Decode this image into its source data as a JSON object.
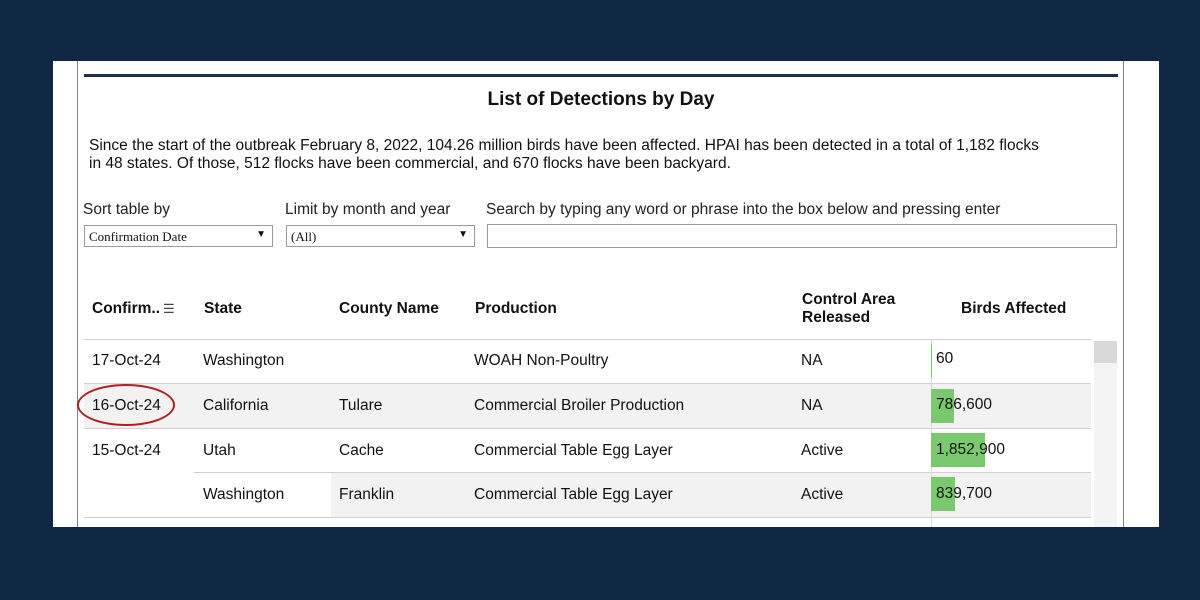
{
  "title": "List of Detections by Day",
  "summary": "Since the start of the outbreak February 8, 2022, 104.26 million birds have been affected.   HPAI has been detected in a total of 1,182 flocks in 48 states. Of those, 512 flocks have been commercial, and 670 flocks have been backyard.",
  "filters": {
    "sort_label": "Sort table by",
    "sort_value": "Confirmation Date",
    "month_label": "Limit by month and year",
    "month_value": "(All)",
    "search_label": "Search by typing any word or phrase into the box below and pressing enter",
    "search_value": ""
  },
  "table": {
    "headers": {
      "confirm": "Confirm..",
      "state": "State",
      "county": "County Name",
      "production": "Production",
      "control_line1": "Control Area",
      "control_line2": "Released",
      "birds": "Birds Affected"
    },
    "rows": [
      {
        "date": "17-Oct-24",
        "state": "Washington",
        "county": "",
        "production": "WOAH Non-Poultry",
        "control": "NA",
        "birds": "60",
        "birds_value": 60
      },
      {
        "date": "16-Oct-24",
        "state": "California",
        "county": "Tulare",
        "production": "Commercial Broiler Production",
        "control": "NA",
        "birds": "786,600",
        "birds_value": 786600
      },
      {
        "date": "15-Oct-24",
        "state": "Utah",
        "county": "Cache",
        "production": "Commercial Table Egg Layer",
        "control": "Active",
        "birds": "1,852,900",
        "birds_value": 1852900
      },
      {
        "date": "",
        "state": "Washington",
        "county": "Franklin",
        "production": "Commercial Table Egg Layer",
        "control": "Active",
        "birds": "839,700",
        "birds_value": 839700
      }
    ]
  },
  "colors": {
    "background": "#0f2742",
    "bar": "#7bc96f",
    "highlight_circle": "#b01f24"
  }
}
